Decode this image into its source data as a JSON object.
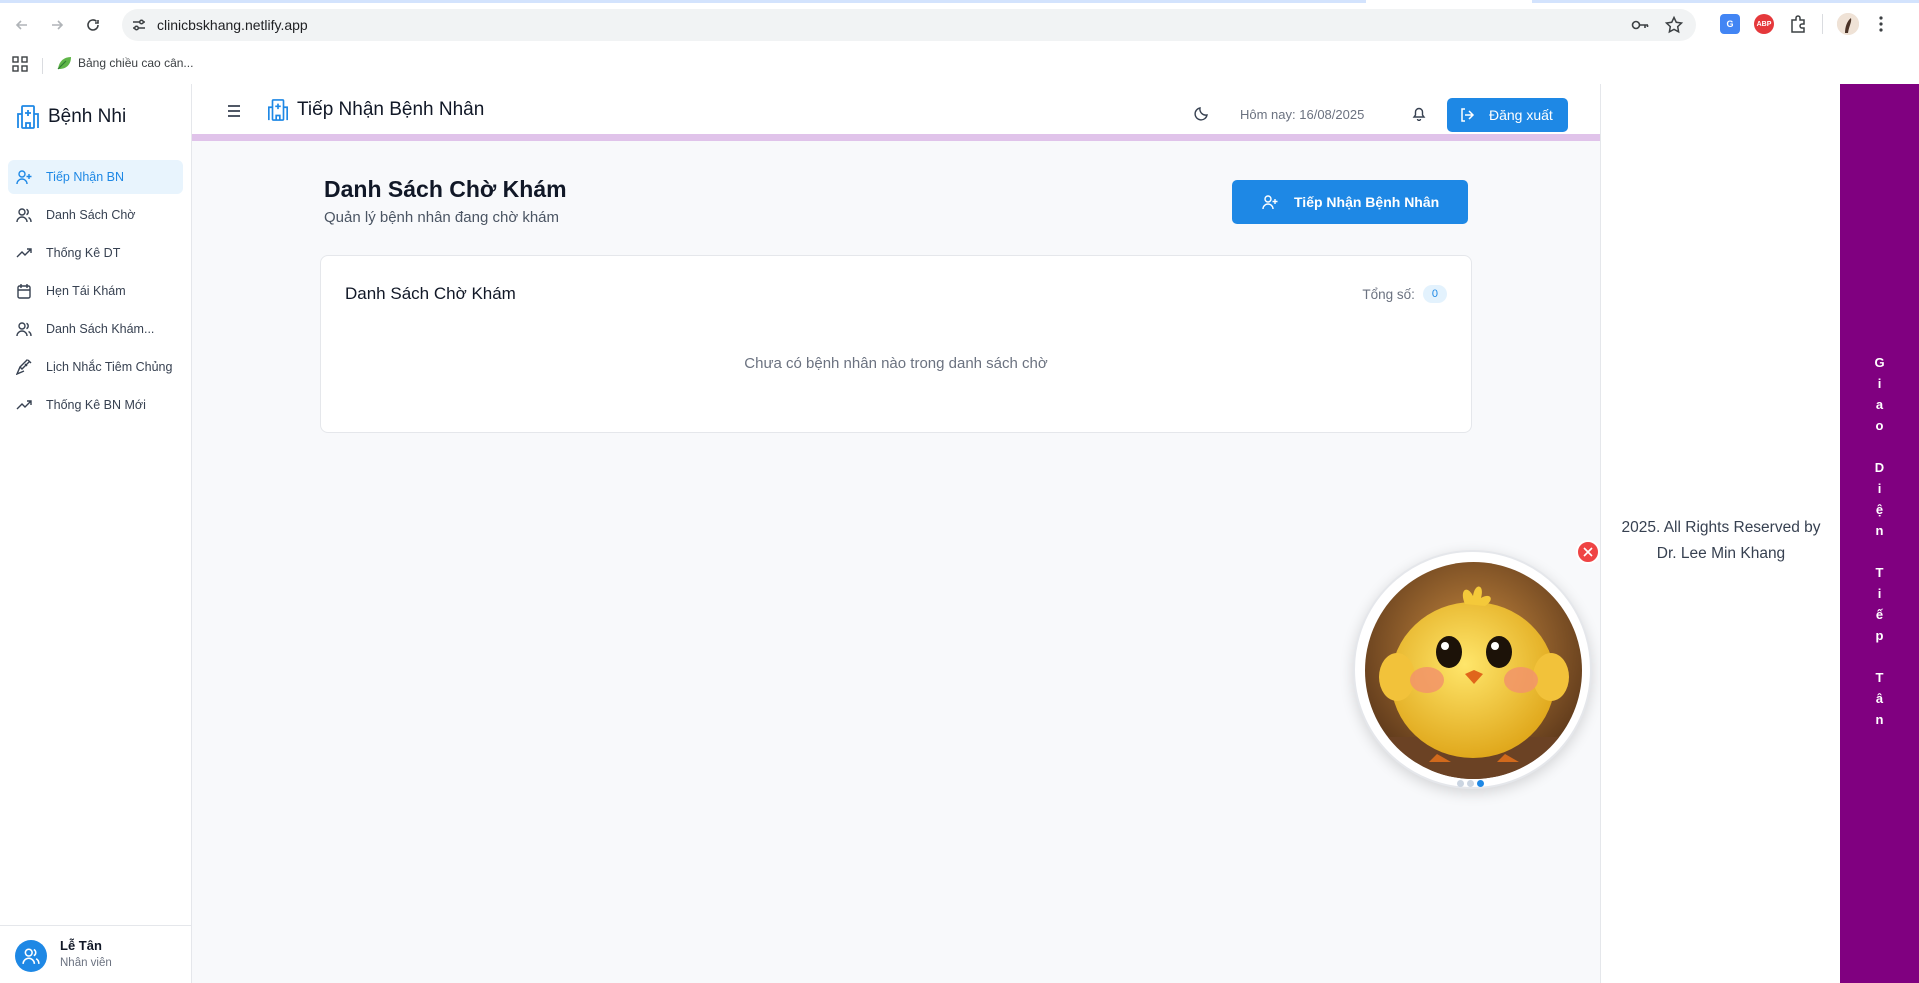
{
  "browser": {
    "url": "clinicbskhang.netlify.app",
    "bookmark_label": "Bảng chiều cao cân..."
  },
  "sidebar": {
    "brand": "Bệnh Nhi",
    "items": [
      {
        "label": "Tiếp Nhận BN",
        "icon": "user-plus-icon",
        "active": true
      },
      {
        "label": "Danh Sách Chờ",
        "icon": "users-icon"
      },
      {
        "label": "Thống Kê DT",
        "icon": "trending-up-icon"
      },
      {
        "label": "Hẹn Tái Khám",
        "icon": "calendar-icon"
      },
      {
        "label": "Danh Sách Khám...",
        "icon": "users-icon"
      },
      {
        "label": "Lịch Nhắc Tiêm Chủng",
        "icon": "syringe-icon"
      },
      {
        "label": "Thống Kê BN Mới",
        "icon": "trending-up-icon"
      }
    ],
    "user": {
      "name": "Lễ Tân",
      "role": "Nhân viên"
    }
  },
  "header": {
    "title": "Tiếp Nhận Bệnh Nhân",
    "today": "Hôm nay: 16/08/2025",
    "logout_label": "Đăng xuất"
  },
  "page": {
    "title": "Danh Sách Chờ Khám",
    "subtitle": "Quản lý bệnh nhân đang chờ khám",
    "add_button": "Tiếp Nhận Bệnh Nhân"
  },
  "card": {
    "title": "Danh Sách Chờ Khám",
    "total_label": "Tổng số:",
    "total_count": "0",
    "empty_message": "Chưa có bệnh nhân nào trong danh sách chờ"
  },
  "right_panel": {
    "copyright_line1": "2025. All Rights Reserved by",
    "copyright_line2": "Dr. Lee Min Khang"
  },
  "vertical_banner": {
    "text": "Giao Diện Tiếp Tân"
  },
  "colors": {
    "accent": "#1e88e5",
    "banner": "#800080",
    "header_strip": "#e0c3ea",
    "close": "#ef4444"
  }
}
